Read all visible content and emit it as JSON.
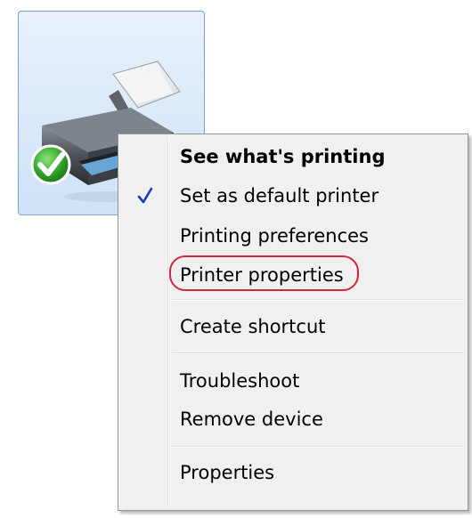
{
  "device": {
    "icon": "printer-icon",
    "status_icon": "default-check-icon",
    "selected": true
  },
  "context_menu": {
    "items": [
      {
        "label": "See what's printing",
        "bold": true
      },
      {
        "label": "Set as default printer",
        "checked": true,
        "check_icon": "checkmark-icon"
      },
      {
        "label": "Printing preferences"
      },
      {
        "label": "Printer properties",
        "highlighted": true
      },
      {
        "label": "Create shortcut"
      },
      {
        "label": "Troubleshoot"
      },
      {
        "label": "Remove device"
      },
      {
        "label": "Properties"
      }
    ],
    "highlight_color": "#d2283b",
    "check_color": "#1a3cb8"
  }
}
